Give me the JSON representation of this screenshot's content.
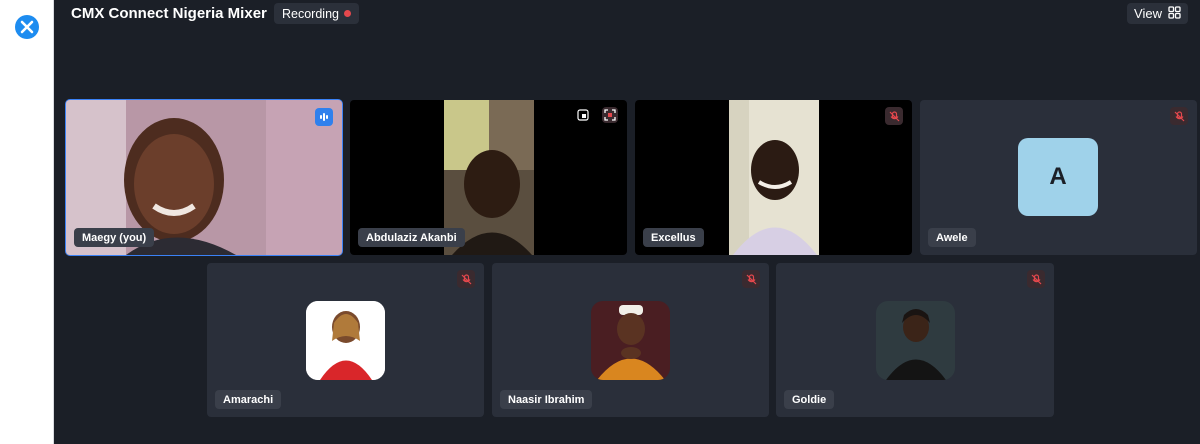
{
  "meeting": {
    "title": "CMX Connect Nigeria Mixer",
    "recording_label": "Recording",
    "view_label": "View"
  },
  "colors": {
    "accent": "#3b82f6",
    "recording_dot": "#e5484d",
    "muted_icon": "#e5484d",
    "avatar_awele_bg": "#9fd2ea"
  },
  "participants": [
    {
      "name": "Maegy (you)",
      "state": "speaking"
    },
    {
      "name": "Abdulaziz Akanbi",
      "state": "video"
    },
    {
      "name": "Excellus",
      "state": "muted"
    },
    {
      "name": "Awele",
      "initial": "A",
      "state": "muted"
    },
    {
      "name": "Amarachi",
      "state": "muted"
    },
    {
      "name": "Naasir Ibrahim",
      "state": "muted"
    },
    {
      "name": "Goldie",
      "state": "muted"
    }
  ],
  "icons": {
    "app_logo": "x-logo-icon",
    "muted": "mic-off-icon",
    "speaking": "audio-level-icon",
    "view": "grid-icon",
    "pin": "pin-icon",
    "fullscreen": "screen-capture-icon"
  }
}
